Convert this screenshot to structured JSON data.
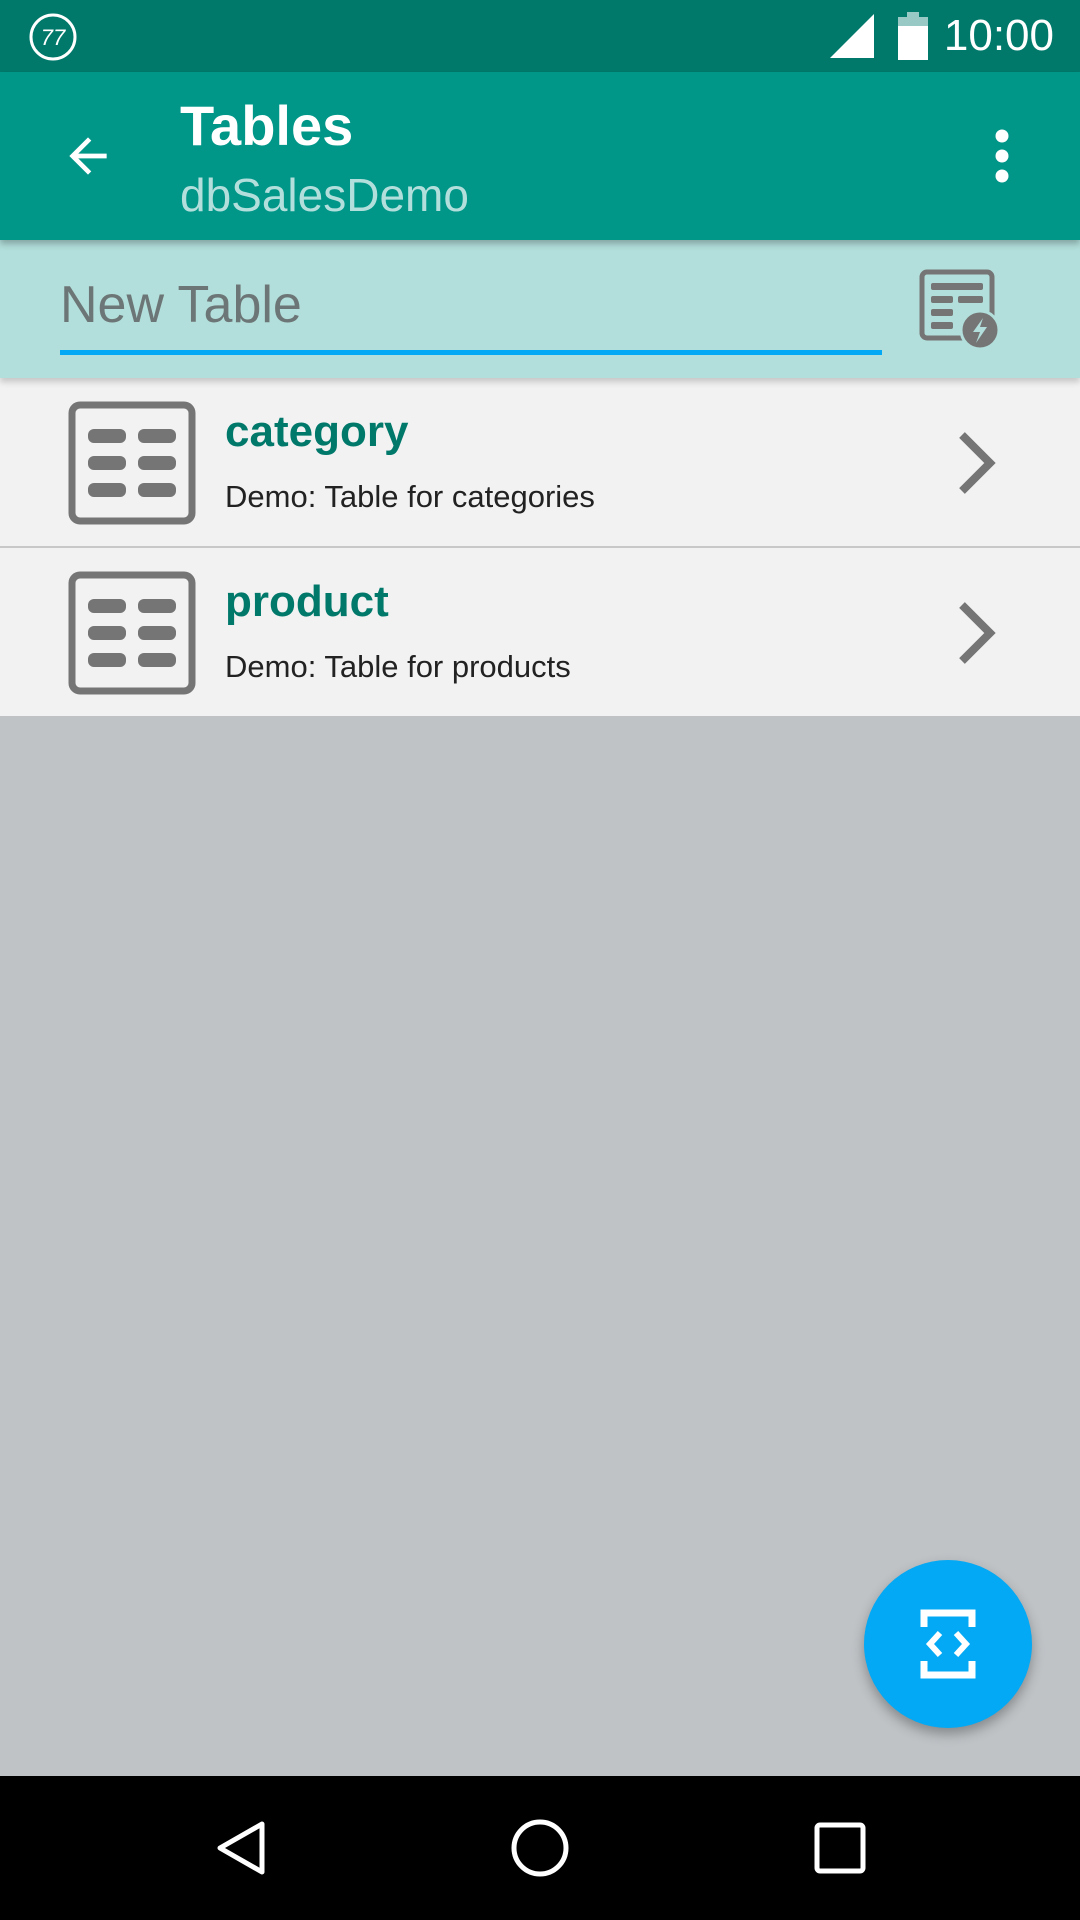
{
  "status_bar": {
    "notification_badge": "77",
    "time": "10:00",
    "icons": [
      "notification-77-icon",
      "cell-signal-icon",
      "battery-icon"
    ]
  },
  "app_bar": {
    "title": "Tables",
    "subtitle": "dbSalesDemo",
    "icons": [
      "arrow-back-icon",
      "more-vert-icon"
    ]
  },
  "new_table": {
    "placeholder": "New Table",
    "value": "",
    "create_icon": "create-table-icon"
  },
  "tables": [
    {
      "name": "category",
      "description": "Demo: Table for categories",
      "icon": "table-grid-icon"
    },
    {
      "name": "product",
      "description": "Demo: Table for products",
      "icon": "table-grid-icon"
    }
  ],
  "fab": {
    "icon": "code-brackets-icon"
  },
  "nav_bar": {
    "icons": [
      "nav-back-icon",
      "nav-home-icon",
      "nav-recents-icon"
    ]
  },
  "colors": {
    "status_bar": "#00796b",
    "app_bar": "#009688",
    "new_table_bar": "#b2dfdb",
    "accent": "#03a9f4",
    "row_title": "#00796b",
    "background": "#bfc3c6"
  }
}
